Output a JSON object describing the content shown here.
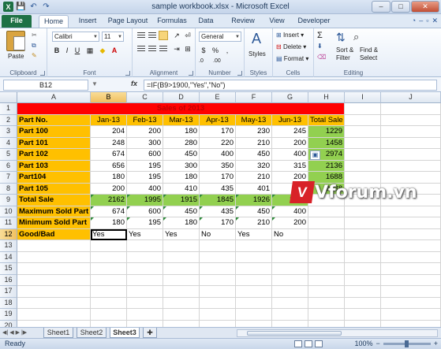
{
  "window": {
    "title": "sample workbook.xlsx  -  Microsoft Excel",
    "min": "–",
    "max": "□",
    "close": "✕"
  },
  "qat": {
    "logo": "X",
    "save": "💾",
    "undo": "↶",
    "redo": "↷"
  },
  "tabs": [
    "File",
    "Home",
    "Insert",
    "Page Layout",
    "Formulas",
    "Data",
    "Review",
    "View",
    "Developer"
  ],
  "active_tab": "Home",
  "ribbon": {
    "clipboard": {
      "label": "Clipboard",
      "paste": "Paste"
    },
    "font": {
      "label": "Font",
      "name": "Calibri",
      "size": "11",
      "bold": "B",
      "italic": "I",
      "underline": "U",
      "grow": "A",
      "shrink": "A"
    },
    "alignment": {
      "label": "Alignment"
    },
    "number": {
      "label": "Number",
      "format": "General",
      "currency": "$",
      "percent": "%",
      "comma": ",",
      "dec_inc": ".0",
      "dec_dec": ".00"
    },
    "styles": {
      "label": "Styles",
      "btn": "Styles"
    },
    "cells": {
      "label": "Cells",
      "insert": "Insert",
      "delete": "Delete",
      "format": "Format"
    },
    "editing": {
      "label": "Editing",
      "sigma": "Σ",
      "sort": "Sort &",
      "filter": "Filter",
      "find": "Find &",
      "select": "Select"
    }
  },
  "formula_bar": {
    "name_box": "B12",
    "fx": "fx",
    "formula": "=IF(B9>1900,\"Yes\",\"No\")"
  },
  "columns": [
    "A",
    "B",
    "C",
    "D",
    "E",
    "F",
    "G",
    "H",
    "I",
    "J"
  ],
  "rows": [
    "1",
    "2",
    "3",
    "4",
    "5",
    "6",
    "7",
    "8",
    "9",
    "10",
    "11",
    "12",
    "13",
    "14",
    "15",
    "16",
    "17",
    "18",
    "19",
    "20",
    "21"
  ],
  "sheet": {
    "title": "Sales of 2013",
    "header_a": "Part No.",
    "months": [
      "Jan-13",
      "Feb-13",
      "Mar-13",
      "Apr-13",
      "May-13",
      "Jun-13"
    ],
    "total_sale_header": "Total Sale",
    "parts": [
      {
        "name": "Part 100",
        "values": [
          "204",
          "200",
          "180",
          "170",
          "230",
          "245"
        ],
        "total": "1229"
      },
      {
        "name": "Part 101",
        "values": [
          "248",
          "300",
          "280",
          "220",
          "210",
          "200"
        ],
        "total": "1458"
      },
      {
        "name": "Part 102",
        "values": [
          "674",
          "600",
          "450",
          "400",
          "450",
          "400"
        ],
        "total": "2974"
      },
      {
        "name": "Part 103",
        "values": [
          "656",
          "195",
          "300",
          "350",
          "320",
          "315"
        ],
        "total": "2136"
      },
      {
        "name": "Part104",
        "values": [
          "180",
          "195",
          "180",
          "170",
          "210",
          "200"
        ],
        "total": "1688"
      },
      {
        "name": "Part 105",
        "values": [
          "200",
          "400",
          "410",
          "435",
          "401",
          "392"
        ],
        "total": "2238"
      }
    ],
    "total_sale_row": {
      "label": "Total Sale",
      "values": [
        "2162",
        "1995",
        "1915",
        "1845",
        "1926",
        "1880"
      ]
    },
    "max_row": {
      "label": "Maximum Sold Part",
      "values": [
        "674",
        "600",
        "450",
        "435",
        "450",
        "400"
      ]
    },
    "min_row": {
      "label": "Minimum Sold Part",
      "values": [
        "180",
        "195",
        "180",
        "170",
        "210",
        "200"
      ]
    },
    "goodbad_row": {
      "label": "Good/Bad",
      "values": [
        "Yes",
        "Yes",
        "Yes",
        "No",
        "Yes",
        "No"
      ]
    }
  },
  "sheet_tabs": [
    "Sheet1",
    "Sheet2",
    "Sheet3"
  ],
  "active_sheet": "Sheet3",
  "status": {
    "ready": "Ready",
    "zoom": "100%",
    "minus": "−",
    "plus": "+"
  },
  "watermark": {
    "mark": "V",
    "text": "Vforum.vn"
  },
  "colors": {
    "red": "#ff0000",
    "gold": "#ffc000",
    "green": "#92d050",
    "title_text": "#c00000"
  }
}
